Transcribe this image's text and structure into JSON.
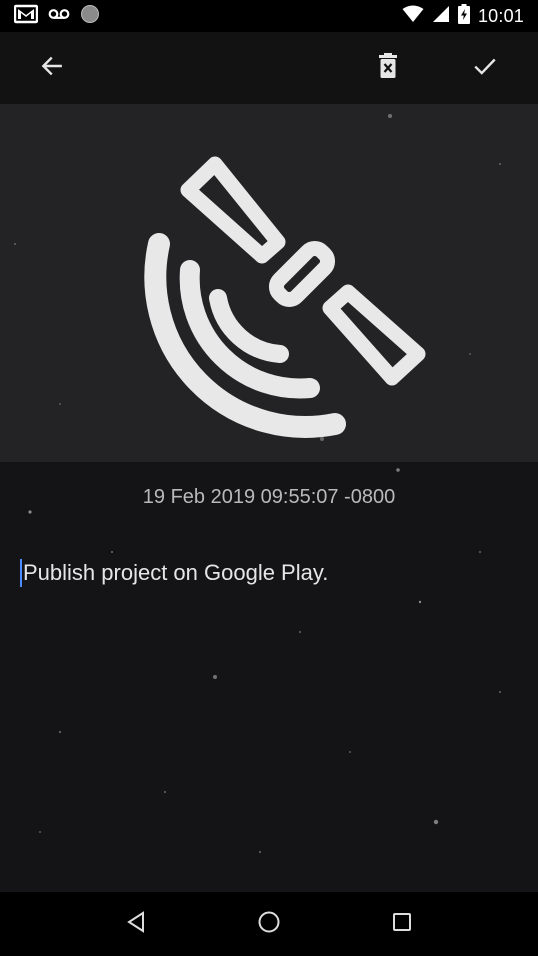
{
  "status_bar": {
    "time": "10:01",
    "icons": [
      "gmail-icon",
      "voicemail-icon",
      "circle-icon",
      "wifi-icon",
      "signal-icon",
      "battery-charging-icon"
    ]
  },
  "toolbar": {
    "back_icon": "arrow-back-icon",
    "delete_icon": "delete-icon",
    "confirm_icon": "check-icon"
  },
  "hero": {
    "logo_icon": "satellite-dish-icon"
  },
  "entry": {
    "timestamp": "19 Feb 2019 09:55:07 -0800",
    "text": "Publish project on Google Play."
  },
  "nav_bar": {
    "back_icon": "nav-back-triangle-icon",
    "home_icon": "nav-home-circle-icon",
    "recents_icon": "nav-recents-square-icon"
  },
  "colors": {
    "background": "#141416",
    "hero": "#232325",
    "logo": "#e8e8e8",
    "timestamp": "#b9b9bb",
    "caret": "#4d8cff"
  }
}
